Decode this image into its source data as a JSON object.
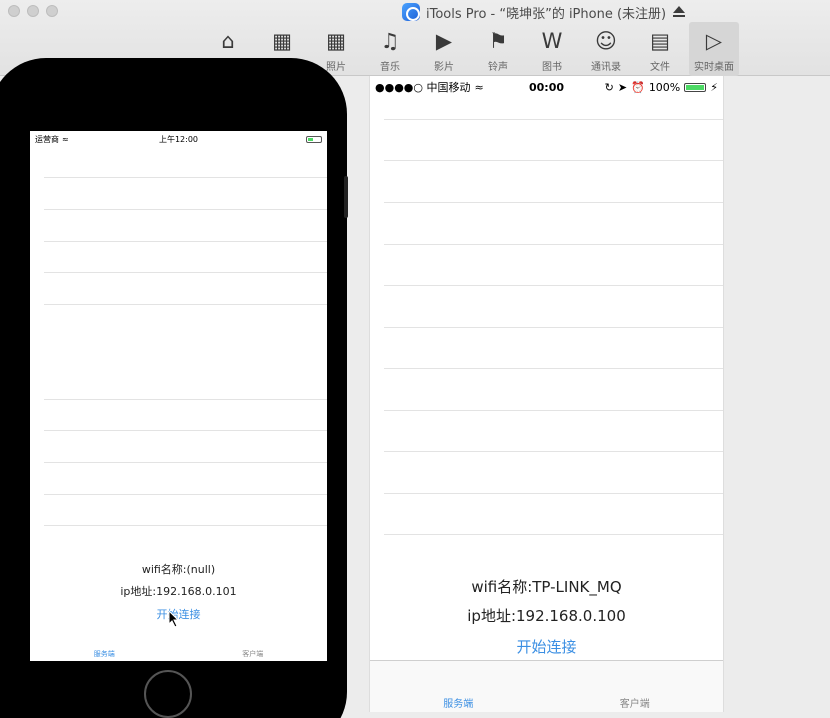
{
  "window": {
    "title": "iTools Pro - “晓坤张”的 iPhone (未注册)"
  },
  "toolbar": {
    "items": [
      {
        "label": "",
        "icon": "home-icon"
      },
      {
        "label": "",
        "icon": "apps-icon"
      },
      {
        "label": "照片",
        "icon": "photo-icon"
      },
      {
        "label": "音乐",
        "icon": "music-icon"
      },
      {
        "label": "影片",
        "icon": "play-icon"
      },
      {
        "label": "铃声",
        "icon": "bell-icon"
      },
      {
        "label": "图书",
        "icon": "book-icon"
      },
      {
        "label": "通讯录",
        "icon": "contacts-icon"
      },
      {
        "label": "文件",
        "icon": "folder-icon"
      },
      {
        "label": "实时桌面",
        "icon": "screen-icon"
      }
    ]
  },
  "simulator": {
    "status": {
      "carrier": "运营商",
      "time": "上午12:00"
    },
    "wifi_name": "wifi名称:(null)",
    "ip": "ip地址:192.168.0.101",
    "connect": "开始连接",
    "tabs": [
      "服务端",
      "客户端"
    ]
  },
  "device": {
    "status": {
      "carrier": "●●●●○ 中国移动",
      "time": "00:00",
      "battery": "100%"
    },
    "wifi_name": "wifi名称:TP-LINK_MQ",
    "ip": "ip地址:192.168.0.100",
    "connect": "开始连接",
    "tabs": [
      "服务端",
      "客户端"
    ]
  },
  "colors": {
    "accent": "#3b8fe3",
    "battery": "#4cd964"
  }
}
